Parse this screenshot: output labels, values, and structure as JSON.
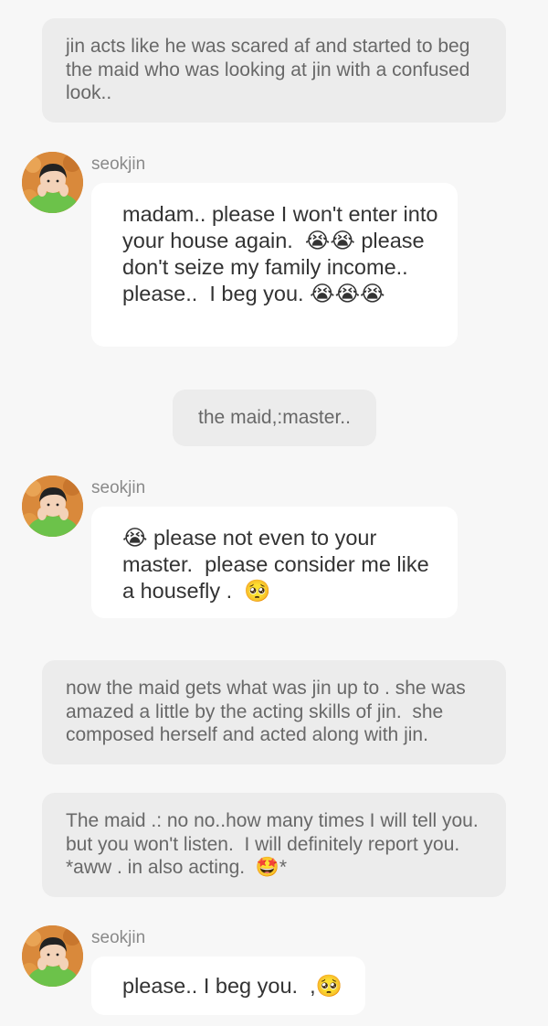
{
  "narration_1": "jin acts like he was scared af and started to beg the maid who was looking at jin with a confused look..",
  "messages": [
    {
      "sender": "seokjin",
      "text": "madam.. please I won't enter into your house again.  😭😭 please don't seize my family income.. please..  I beg you. 😭😭😭"
    },
    {
      "sender": "seokjin",
      "text": "😭 please not even to your master.  please consider me like a housefly .  🥺"
    },
    {
      "sender": "seokjin",
      "text": "please.. I beg you.  ,🥺"
    }
  ],
  "maid_line": "the maid,:master..",
  "narration_2": "now the maid gets what was jin up to . she was amazed a little by the acting skills of jin.  she composed herself and acted along with jin.",
  "narration_3": "The maid .: no no..how many times I will tell you.  but you won't listen.  I will definitely report you. *aww . in also acting.  🤩*",
  "avatar_icon": "seokjin-avatar-photo"
}
